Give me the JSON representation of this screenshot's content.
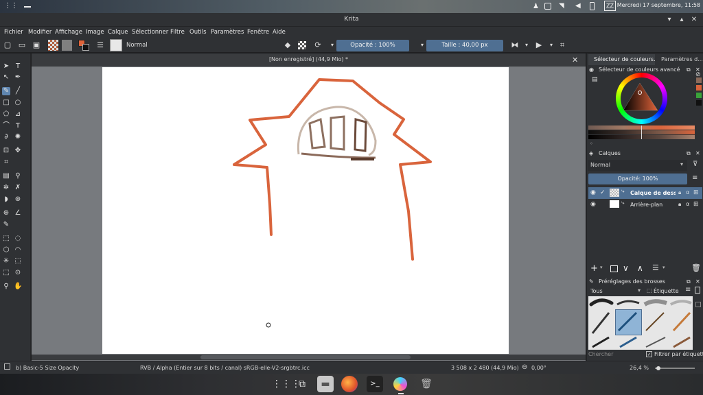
{
  "system": {
    "clock": "Mercredi 17 septembre, 11:58",
    "zz_badge": "ZZ"
  },
  "window": {
    "title": "Krita"
  },
  "menu": [
    "Fichier",
    "Modifier",
    "Affichage",
    "Image",
    "Calque",
    "Sélectionner",
    "Filtre",
    "Outils",
    "Paramètres",
    "Fenêtre",
    "Aide"
  ],
  "toolbar": {
    "blend_mode": "Normal",
    "opacity": "Opacité : 100%",
    "size": "Taille : 40,00 px"
  },
  "document": {
    "title": "[Non enregistré]  (44,9 Mio) *"
  },
  "dock": {
    "tab_color": "Sélecteur de couleurs...",
    "tab_params": "Paramètres d...",
    "color_panel_title": "Sélecteur de couleurs avancé",
    "layers_title": "Calques",
    "layers_blend": "Normal",
    "layers_opacity": "Opacité:  100%",
    "layers": [
      {
        "name": "Calque de dessi...",
        "selected": true
      },
      {
        "name": "Arrière-plan",
        "selected": false
      }
    ],
    "brushes_title": "Préréglages des brosses",
    "brush_filter": "Tous",
    "brush_tag": "Étiquette",
    "search_placeholder": "Chercher",
    "filter_by_tag": "Filtrer par étiquette"
  },
  "status": {
    "brush": "b) Basic-5 Size Opacity",
    "colorspace": "RVB / Alpha (Entier sur 8 bits / canal)  sRGB-elle-V2-srgbtrc.icc",
    "dimensions": "3 508 x 2 480 (44,9 Mio)",
    "rotation": "0,00°",
    "zoom": "26,4 %"
  },
  "colors": {
    "accent": "#4f6f92",
    "stroke": "#d9643c",
    "dark_brown": "#6b4a3a"
  }
}
